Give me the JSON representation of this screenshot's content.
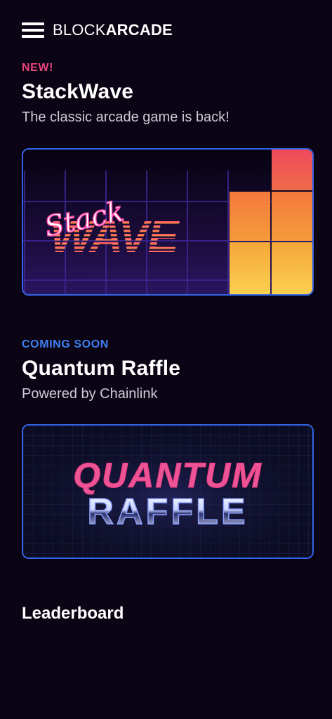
{
  "header": {
    "brand_light": "BLOCK",
    "brand_bold": "ARCADE",
    "menu_icon": "hamburger-menu-icon"
  },
  "featured": {
    "tag": "NEW!",
    "tag_color": "#e8457a",
    "title": "StackWave",
    "subtitle": "The classic arcade game is back!",
    "banner_script_text": "Stack",
    "banner_block_text": "WAVE"
  },
  "upcoming": {
    "tag": "COMING SOON",
    "tag_color": "#3d7ff2",
    "title": "Quantum Raffle",
    "subtitle": "Powered by Chainlink",
    "banner_top_text": "QUANTUM",
    "banner_bottom_text": "RAFFLE"
  },
  "leaderboard": {
    "title": "Leaderboard"
  },
  "colors": {
    "background": "#0b0414",
    "card_border": "#3264e6"
  }
}
